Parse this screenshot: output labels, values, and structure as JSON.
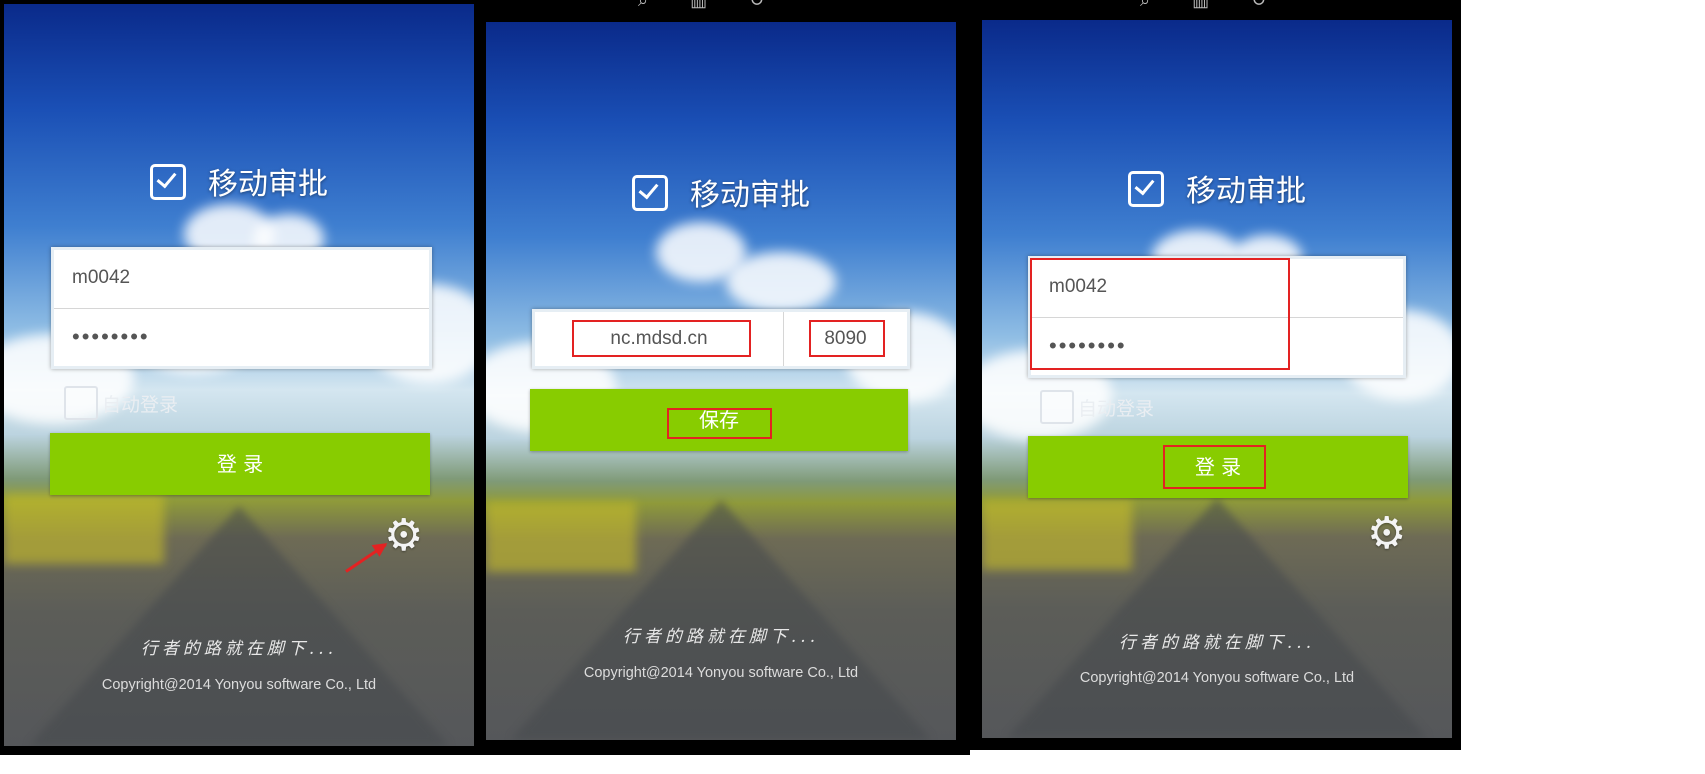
{
  "login": {
    "title": "移动审批",
    "username": "m0042",
    "password_mask": "••••••••",
    "auto_login_label": "自动登录",
    "login_button": "登 录",
    "motto": "行者的路就在脚下...",
    "copyright": "Copyright@2014 Yonyou software Co., Ltd"
  },
  "settings": {
    "title": "移动审批",
    "server_address": "nc.mdsd.cn",
    "port": "8090",
    "save_button": "保存",
    "motto": "行者的路就在脚下...",
    "copyright": "Copyright@2014 Yonyou software Co., Ltd"
  },
  "login_after": {
    "title": "移动审批",
    "username": "m0042",
    "password_mask": "••••••••",
    "auto_login_label": "自动登录",
    "login_button": "登 录",
    "motto": "行者的路就在脚下...",
    "copyright": "Copyright@2014 Yonyou software Co., Ltd"
  },
  "icons": {
    "gear": "gear-icon",
    "app_logo": "checkbox-icon",
    "search": "search-icon",
    "delete": "trash-icon",
    "rotate": "rotate-icon",
    "accent_color": "#88cc00",
    "highlight_color": "#e32222"
  }
}
